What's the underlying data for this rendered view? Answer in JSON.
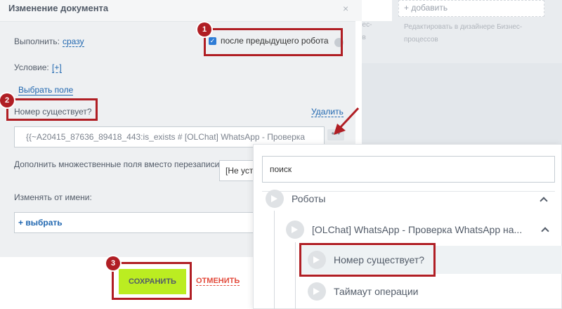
{
  "dialog": {
    "title": "Изменение документа",
    "close": "×"
  },
  "form": {
    "execute_label": "Выполнить:",
    "execute_value": "сразу",
    "after_prev_label": "после предыдущего робота",
    "condition_label": "Условие:",
    "condition_value": "[+]",
    "select_field": "Выбрать поле",
    "field_label": "Номер существует?",
    "delete": "Удалить",
    "field_value": "{{~A20415_87636_89418_443:is_exists # [OLChat] WhatsApp - Проверка",
    "dots": "•••",
    "append_label": "Дополнить множественные поля вместо перезаписи:",
    "append_value": "[Не уст",
    "change_as_label": "Изменять от имени:",
    "choose": "+ выбрать"
  },
  "footer": {
    "save": "СОХРАНИТЬ",
    "cancel": "ОТМЕНИТЬ"
  },
  "background": {
    "add": "+ добавить",
    "edit": "Редактировать в дизайнере Бизнес-процессов",
    "frag1": "нес-",
    "frag2": "ов"
  },
  "popup": {
    "search_value": "поиск",
    "tree": {
      "root": "Роботы",
      "child": "[OLChat] WhatsApp - Проверка WhatsApp на...",
      "items": [
        "Номер существует?",
        "Таймаут операции"
      ]
    }
  },
  "badges": [
    "1",
    "2",
    "3"
  ],
  "colors": {
    "accent": "#2067b0",
    "save": "#bbed21",
    "cancel": "#e24a3b",
    "highlight": "#b01e24"
  }
}
